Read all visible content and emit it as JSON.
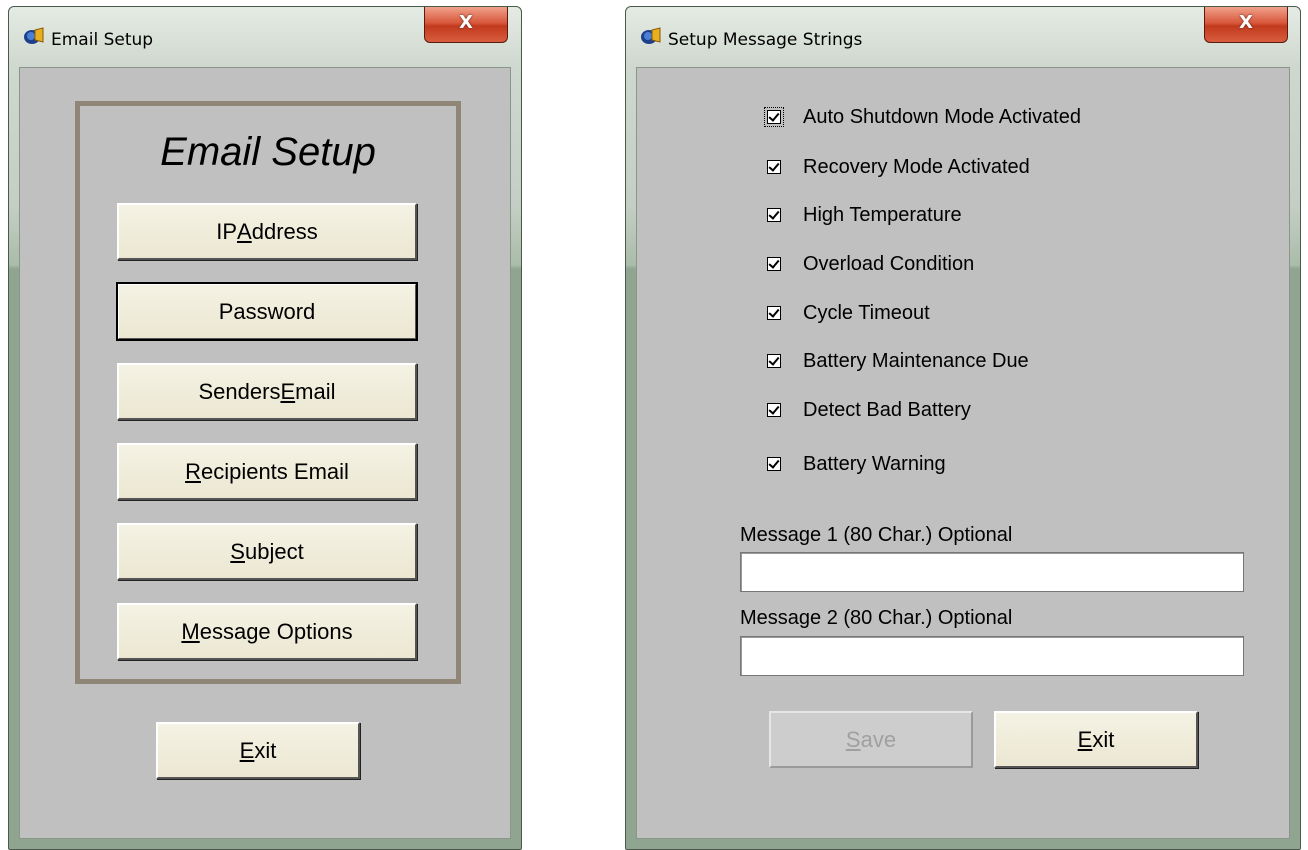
{
  "email_setup": {
    "window_title": "Email Setup",
    "close_label": "X",
    "heading": "Email Setup",
    "buttons": [
      {
        "pre": "IP ",
        "mn": "A",
        "post": "ddress"
      },
      {
        "pre": "Password",
        "mn": "",
        "post": ""
      },
      {
        "pre": "Senders ",
        "mn": "E",
        "post": "mail"
      },
      {
        "pre": "",
        "mn": "R",
        "post": "ecipients Email"
      },
      {
        "pre": "",
        "mn": "S",
        "post": "ubject"
      },
      {
        "pre": "",
        "mn": "M",
        "post": "essage Options"
      }
    ],
    "exit": {
      "pre": "",
      "mn": "E",
      "post": "xit"
    }
  },
  "message_strings": {
    "window_title": "Setup Message Strings",
    "close_label": "X",
    "checkboxes": [
      {
        "label": "Auto Shutdown Mode Activated",
        "checked": true
      },
      {
        "label": "Recovery Mode Activated",
        "checked": true
      },
      {
        "label": "High Temperature",
        "checked": true
      },
      {
        "label": "Overload Condition",
        "checked": true
      },
      {
        "label": "Cycle Timeout",
        "checked": true
      },
      {
        "label": "Battery Maintenance Due",
        "checked": true
      },
      {
        "label": "Detect Bad Battery",
        "checked": true
      },
      {
        "label": "Battery Warning",
        "checked": true
      }
    ],
    "message1_label": "Message 1 (80 Char.) Optional",
    "message1_value": "",
    "message2_label": "Message 2  (80 Char.) Optional",
    "message2_value": "",
    "save": {
      "pre": "",
      "mn": "S",
      "post": "ave"
    },
    "exit": {
      "pre": "",
      "mn": "E",
      "post": "xit"
    }
  },
  "colors": {
    "client_bg": "#c0c0c0",
    "button_face": "#ebe7d2",
    "frame_border": "#8f8677",
    "close_button": "#c23a1e"
  }
}
